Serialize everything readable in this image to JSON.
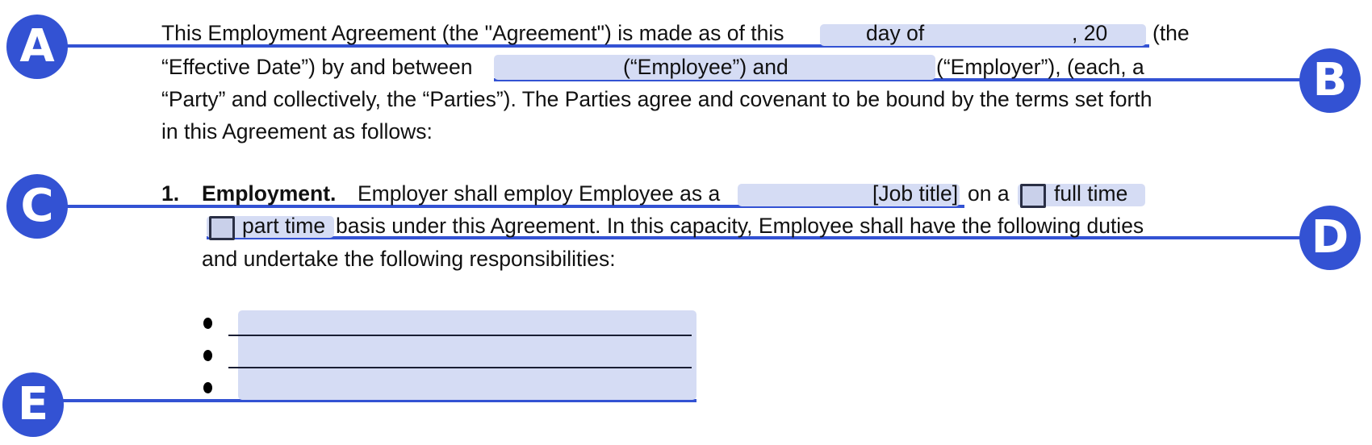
{
  "markers": [
    "A",
    "B",
    "C",
    "D",
    "E"
  ],
  "intro": {
    "line1_text": "This Employment Agreement (the \"Agreement\") is made as of this",
    "day_of": "day of",
    "year_prefix": ", 20",
    "line1_end": "(the",
    "line2_start": "“Effective Date”) by and between",
    "employee_label": "(“Employee”) and",
    "line2_end": "(“Employer”), (each, a",
    "line3": "“Party” and collectively, the “Parties”). The Parties agree and covenant to be bound by the terms set forth",
    "line4": "in this Agreement as follows:"
  },
  "section1": {
    "number": "1.",
    "heading": "Employment.",
    "text1": "Employer shall employ Employee as a",
    "job_title_placeholder": "[Job title]",
    "on_a": "on a",
    "full_time_label": "full time",
    "part_time_label": "part time",
    "text2": "basis under this Agreement. In this capacity, Employee shall have the following duties",
    "text3": "and undertake the following responsibilities:"
  },
  "colors": {
    "accent": "#3352d3",
    "field_bg": "#d5dcf4"
  }
}
